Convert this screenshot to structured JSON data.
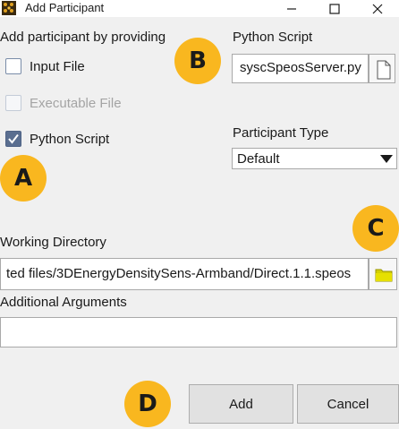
{
  "window": {
    "title": "Add Participant",
    "controls": {
      "minimize": "minimize",
      "maximize": "maximize",
      "close": "close"
    }
  },
  "participant": {
    "provide_label": "Add participant by providing",
    "options": [
      {
        "label": "Input File",
        "checked": false,
        "enabled": true
      },
      {
        "label": "Executable File",
        "checked": false,
        "enabled": false
      },
      {
        "label": "Python Script",
        "checked": true,
        "enabled": true
      }
    ],
    "python_script": {
      "label": "Python Script",
      "value": "syscSpeosServer.py",
      "browse_icon": "file-icon"
    },
    "type": {
      "label": "Participant Type",
      "selected": "Default"
    }
  },
  "working_directory": {
    "label": "Working Directory",
    "value": "ted files/3DEnergyDensitySens-Armband/Direct.1.1.speos",
    "browse_icon": "folder-icon"
  },
  "additional_arguments": {
    "label": "Additional Arguments",
    "value": ""
  },
  "buttons": {
    "add": "Add",
    "cancel": "Cancel"
  },
  "annotations": {
    "a": "A",
    "b": "B",
    "c": "C",
    "d": "D",
    "color": "#f9b71f"
  },
  "colors": {
    "checkbox_checked": "#5a6e90",
    "folder": "#d4d000"
  }
}
